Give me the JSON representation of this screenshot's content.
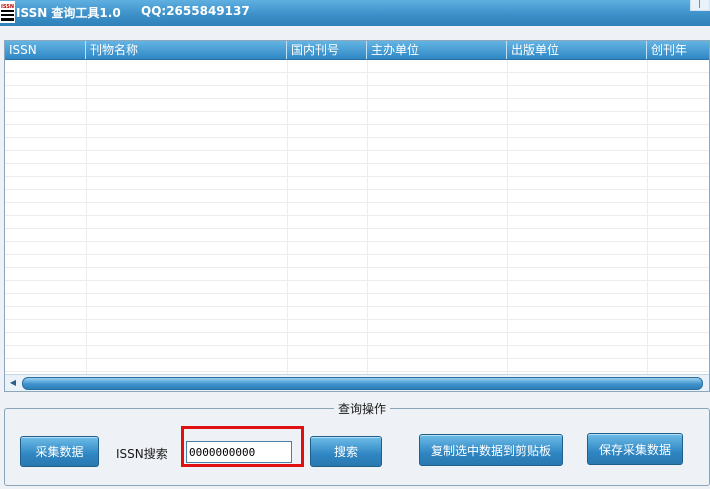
{
  "window": {
    "title": "ISSN 查询工具1.0",
    "qq": "QQ:2655849137",
    "logo_text": "ISSN"
  },
  "table": {
    "columns": [
      "ISSN",
      "刊物名称",
      "国内刊号",
      "主办单位",
      "出版单位",
      "创刊年"
    ],
    "rows": []
  },
  "group": {
    "title": "查询操作"
  },
  "buttons": {
    "collect": "采集数据",
    "search": "搜索",
    "copy": "复制选中数据到剪贴板",
    "save": "保存采集数据"
  },
  "search": {
    "label": "ISSN搜索",
    "value": "0000000000"
  },
  "colors": {
    "accent": "#3d91c9",
    "highlight": "#e01010"
  }
}
